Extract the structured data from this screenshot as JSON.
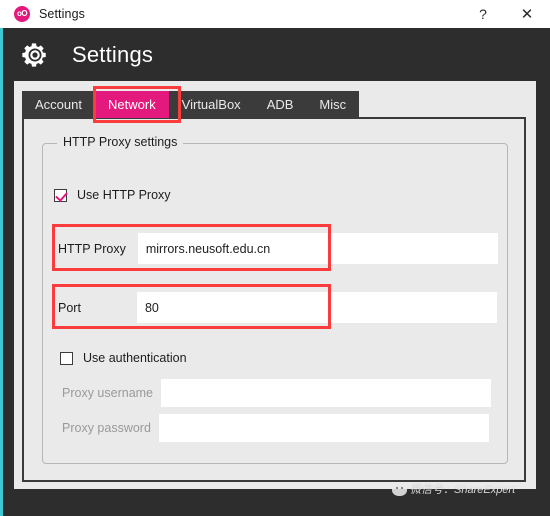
{
  "window": {
    "app_icon_text": "oO",
    "title": "Settings",
    "help_button": "?",
    "close_button": "✕",
    "accent_color": "#e4197d",
    "left_accent_color": "#3ec8d2",
    "annotation_color": "#fa3c3c"
  },
  "header": {
    "title": "Settings"
  },
  "tabs": [
    {
      "label": "Account",
      "active": false
    },
    {
      "label": "Network",
      "active": true
    },
    {
      "label": "VirtualBox",
      "active": false
    },
    {
      "label": "ADB",
      "active": false
    },
    {
      "label": "Misc",
      "active": false
    }
  ],
  "group": {
    "title": "HTTP Proxy settings"
  },
  "use_http_proxy": {
    "label": "Use HTTP Proxy",
    "checked": true
  },
  "proxy": {
    "label": "HTTP Proxy",
    "value": "mirrors.neusoft.edu.cn",
    "placeholder": ""
  },
  "port": {
    "label": "Port",
    "value": "80",
    "placeholder": ""
  },
  "use_authentication": {
    "label": "Use authentication",
    "checked": false
  },
  "proxy_username": {
    "label": "Proxy username",
    "value": "",
    "placeholder": "",
    "disabled": true
  },
  "proxy_password": {
    "label": "Proxy password",
    "value": "",
    "placeholder": "",
    "disabled": true
  },
  "watermark": {
    "text": "微信号：ShareExpert"
  }
}
